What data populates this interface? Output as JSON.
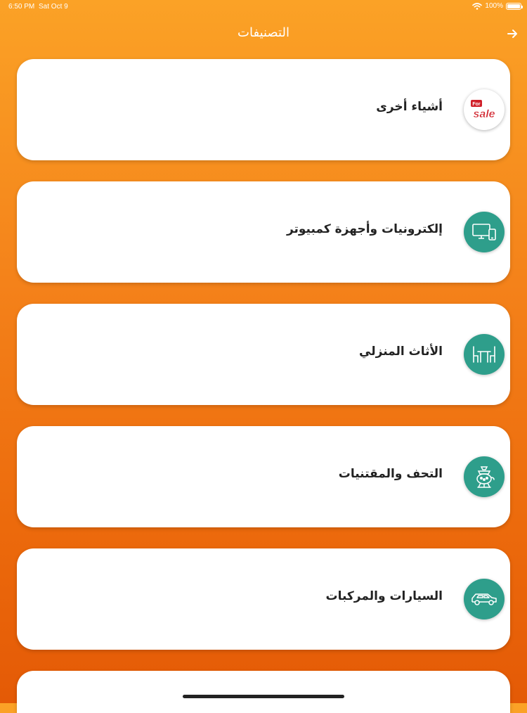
{
  "status_bar": {
    "time": "6:50 PM",
    "date": "Sat Oct 9",
    "battery": "100%"
  },
  "header": {
    "title": "التصنيفات",
    "back_icon": "arrow-right-icon"
  },
  "categories": [
    {
      "label": "أشياء أخرى",
      "icon": "for-sale-icon",
      "icon_text_top": "For",
      "icon_text_bottom": "sale"
    },
    {
      "label": "إلكترونيات وأجهزة كمبيوتر",
      "icon": "devices-icon"
    },
    {
      "label": "الأثاث المنزلي",
      "icon": "furniture-icon"
    },
    {
      "label": "التحف والمقتنيات",
      "icon": "antique-icon"
    },
    {
      "label": "السيارات والمركبات",
      "icon": "car-icon"
    }
  ],
  "colors": {
    "accent": "#2E9E8B",
    "background_top": "#FBA226",
    "background_bottom": "#E45A06"
  }
}
